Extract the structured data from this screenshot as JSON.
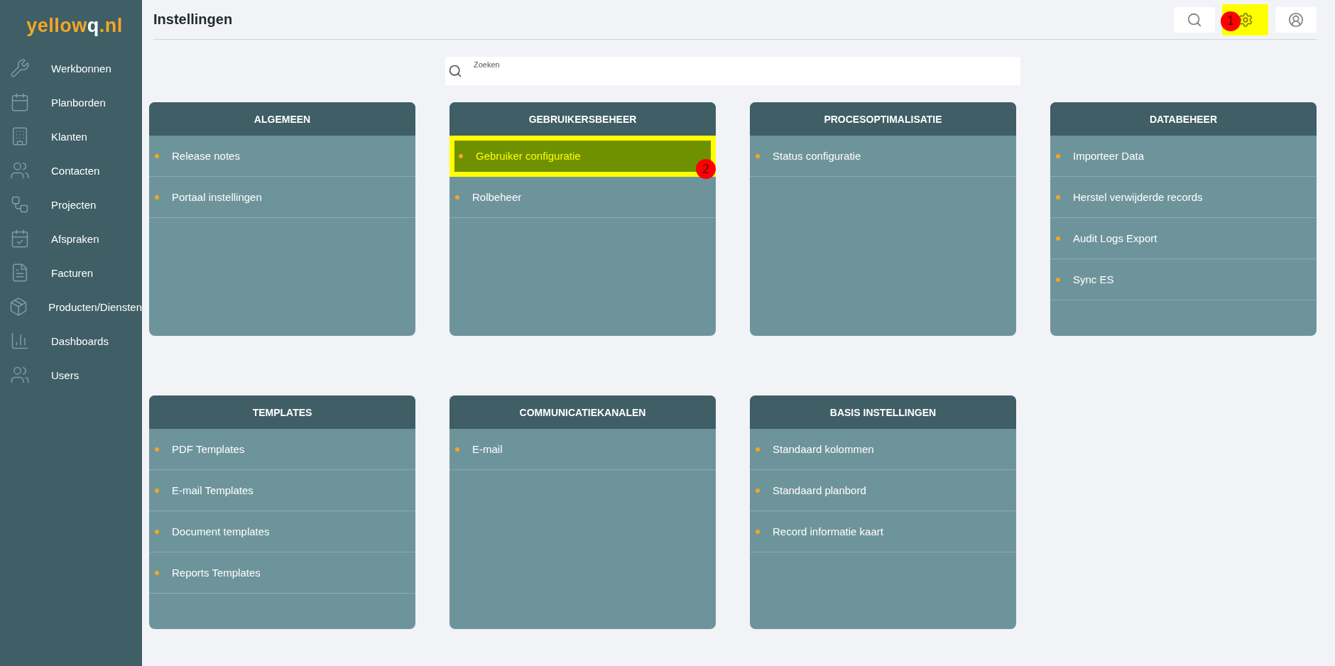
{
  "sidebar": {
    "logo": {
      "main": "yellow",
      "accent": "q",
      "suffix": ".nl"
    },
    "items": [
      {
        "label": "Werkbonnen"
      },
      {
        "label": "Planborden"
      },
      {
        "label": "Klanten"
      },
      {
        "label": "Contacten"
      },
      {
        "label": "Projecten"
      },
      {
        "label": "Afspraken"
      },
      {
        "label": "Facturen"
      },
      {
        "label": "Producten/Diensten"
      },
      {
        "label": "Dashboards"
      },
      {
        "label": "Users"
      }
    ]
  },
  "header": {
    "title": "Instellingen",
    "buttons": [
      {
        "kind": "search",
        "highlighted": false
      },
      {
        "kind": "settings",
        "highlighted": true,
        "marker": "1"
      },
      {
        "kind": "account",
        "highlighted": false
      }
    ]
  },
  "search": {
    "placeholder": "Zoeken"
  },
  "cards": [
    {
      "title": "ALGEMEEN",
      "items": [
        {
          "label": "Release notes",
          "highlighted": false
        },
        {
          "label": "Portaal instellingen",
          "highlighted": false
        }
      ]
    },
    {
      "title": "GEBRUIKERSBEHEER",
      "items": [
        {
          "label": "Gebruiker configuratie",
          "highlighted": true,
          "marker": "2"
        },
        {
          "label": "Rolbeheer",
          "highlighted": false
        }
      ]
    },
    {
      "title": "PROCESOPTIMALISATIE",
      "items": [
        {
          "label": "Status configuratie",
          "highlighted": false
        }
      ]
    },
    {
      "title": "DATABEHEER",
      "items": [
        {
          "label": "Importeer Data",
          "highlighted": false
        },
        {
          "label": "Herstel verwijderde records",
          "highlighted": false
        },
        {
          "label": "Audit Logs Export",
          "highlighted": false
        },
        {
          "label": "Sync ES",
          "highlighted": false
        }
      ]
    },
    {
      "title": "TEMPLATES",
      "items": [
        {
          "label": "PDF Templates",
          "highlighted": false
        },
        {
          "label": "E-mail Templates",
          "highlighted": false
        },
        {
          "label": "Document templates",
          "highlighted": false
        },
        {
          "label": "Reports Templates",
          "highlighted": false
        }
      ]
    },
    {
      "title": "COMMUNICATIEKANALEN",
      "items": [
        {
          "label": "E-mail",
          "highlighted": false
        }
      ]
    },
    {
      "title": "BASIS INSTELLINGEN",
      "items": [
        {
          "label": "Standaard kolommen",
          "highlighted": false
        },
        {
          "label": "Standaard planbord",
          "highlighted": false
        },
        {
          "label": "Record informatie kaart",
          "highlighted": false
        }
      ]
    }
  ]
}
